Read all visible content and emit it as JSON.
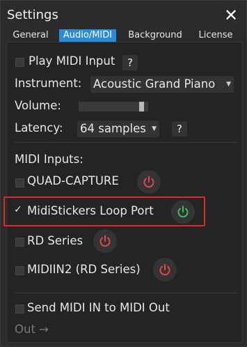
{
  "window": {
    "title": "Settings"
  },
  "tabs": [
    {
      "label": "General"
    },
    {
      "label": "Audio/MIDI"
    },
    {
      "label": "Background"
    },
    {
      "label": "License"
    }
  ],
  "audio": {
    "play_midi_input": {
      "label": "Play MIDI Input",
      "checked": false,
      "help": "?"
    },
    "instrument": {
      "label": "Instrument:",
      "value": "Acoustic Grand Piano"
    },
    "volume": {
      "label": "Volume:",
      "level": 0.94
    },
    "latency": {
      "label": "Latency:",
      "value": "64 samples",
      "help": "?"
    }
  },
  "midi_inputs": {
    "heading": "MIDI Inputs:",
    "devices": [
      {
        "name": "QUAD-CAPTURE",
        "checked": false,
        "power": "off"
      },
      {
        "name": "MidiStickers Loop Port",
        "checked": true,
        "power": "on"
      },
      {
        "name": "RD Series",
        "checked": false,
        "power": "off"
      },
      {
        "name": "MIDIIN2 (RD Series)",
        "checked": false,
        "power": "off"
      }
    ]
  },
  "forward": {
    "label": "Send MIDI IN to MIDI Out",
    "checked": false
  },
  "out": {
    "label": "Out →"
  },
  "colors": {
    "accent": "#2c8bd8",
    "power_off": "#e04848",
    "power_on": "#3fbf5a",
    "highlight": "#e3262b"
  }
}
